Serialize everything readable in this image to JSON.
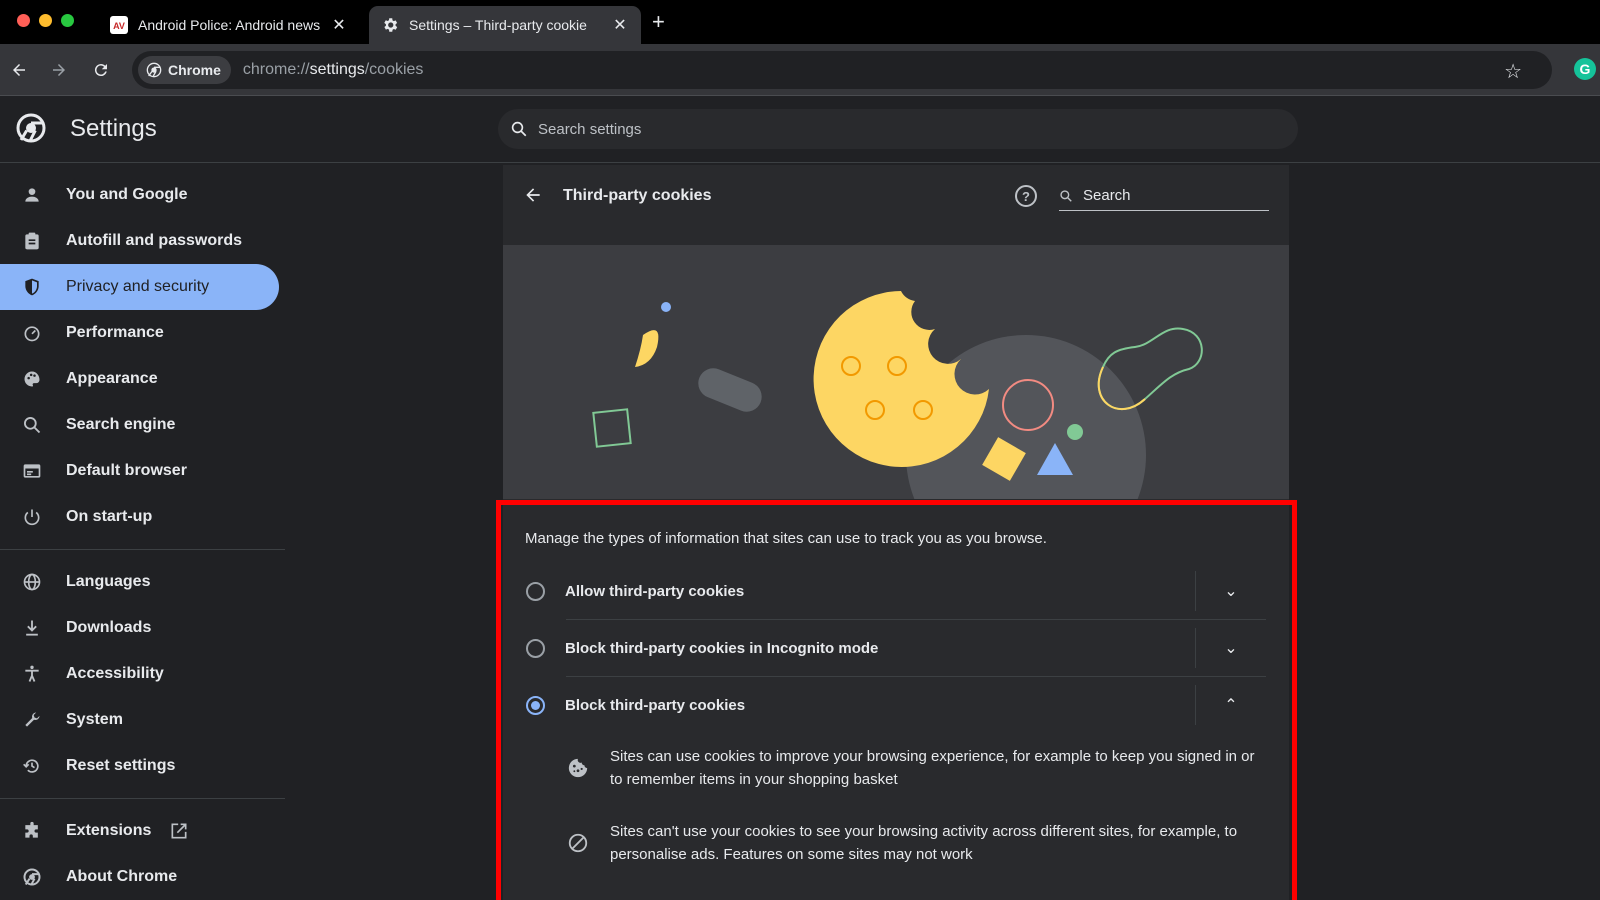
{
  "browser": {
    "tabs": [
      {
        "title": "Android Police: Android news",
        "favicon": "android-police-icon",
        "active": false
      },
      {
        "title": "Settings – Third-party cookie",
        "favicon": "gear-icon",
        "active": true
      }
    ],
    "chip_label": "Chrome",
    "url_prefix": "chrome://",
    "url_host": "settings",
    "url_path": "/cookies",
    "extension_letter": "G"
  },
  "header": {
    "title": "Settings",
    "search_placeholder": "Search settings"
  },
  "sidebar": {
    "group1": [
      {
        "label": "You and Google",
        "icon": "person-icon"
      },
      {
        "label": "Autofill and passwords",
        "icon": "clipboard-icon"
      },
      {
        "label": "Privacy and security",
        "icon": "shield-icon",
        "active": true
      },
      {
        "label": "Performance",
        "icon": "speedometer-icon"
      },
      {
        "label": "Appearance",
        "icon": "palette-icon"
      },
      {
        "label": "Search engine",
        "icon": "search-icon"
      },
      {
        "label": "Default browser",
        "icon": "browser-window-icon"
      },
      {
        "label": "On start-up",
        "icon": "power-icon"
      }
    ],
    "group2": [
      {
        "label": "Languages",
        "icon": "globe-icon"
      },
      {
        "label": "Downloads",
        "icon": "download-icon"
      },
      {
        "label": "Accessibility",
        "icon": "accessibility-icon"
      },
      {
        "label": "System",
        "icon": "wrench-icon"
      },
      {
        "label": "Reset settings",
        "icon": "history-icon"
      }
    ],
    "group3": [
      {
        "label": "Extensions",
        "icon": "puzzle-icon"
      },
      {
        "label": "About Chrome",
        "icon": "chrome-logo-icon"
      }
    ]
  },
  "panel": {
    "title": "Third-party cookies",
    "search_placeholder": "Search",
    "description": "Manage the types of information that sites can use to track you as you browse.",
    "options": [
      {
        "label": "Allow third-party cookies",
        "selected": false,
        "expanded": false
      },
      {
        "label": "Block third-party cookies in Incognito mode",
        "selected": false,
        "expanded": false
      },
      {
        "label": "Block third-party cookies",
        "selected": true,
        "expanded": true
      }
    ],
    "details": [
      {
        "icon": "cookie-icon",
        "text": "Sites can use cookies to improve your browsing experience, for example to keep you signed in or to remember items in your shopping basket"
      },
      {
        "icon": "block-icon",
        "text": "Sites can't use your cookies to see your browsing activity across different sites, for example, to personalise ads. Features on some sites may not work"
      }
    ]
  },
  "colors": {
    "accent": "#8ab4f8",
    "highlight_border": "#ff0000",
    "cookie": "#fdd663"
  }
}
